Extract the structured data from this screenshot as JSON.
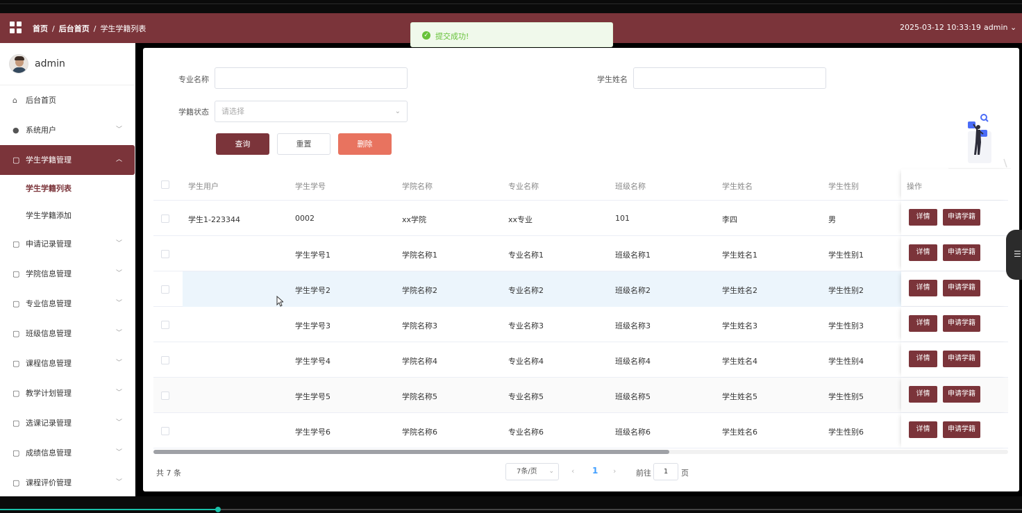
{
  "header": {
    "breadcrumbs": [
      "首页",
      "后台首页",
      "学生学籍列表"
    ],
    "datetime": "2025-03-12 10:33:19",
    "user": "admin",
    "bg_color": "#7b343a"
  },
  "toast": {
    "message": "提交成功!",
    "type": "success"
  },
  "sidebar": {
    "username": "admin",
    "items": [
      {
        "label": "后台首页",
        "icon": "home-icon",
        "expandable": false
      },
      {
        "label": "系统用户",
        "icon": "user-icon",
        "expandable": true
      },
      {
        "label": "学生学籍管理",
        "icon": "folder-icon",
        "expandable": true,
        "active": true
      },
      {
        "label": "申请记录管理",
        "icon": "folder-icon",
        "expandable": true
      },
      {
        "label": "学院信息管理",
        "icon": "folder-icon",
        "expandable": true
      },
      {
        "label": "专业信息管理",
        "icon": "folder-icon",
        "expandable": true
      },
      {
        "label": "班级信息管理",
        "icon": "folder-icon",
        "expandable": true
      },
      {
        "label": "课程信息管理",
        "icon": "folder-icon",
        "expandable": true
      },
      {
        "label": "教学计划管理",
        "icon": "folder-icon",
        "expandable": true
      },
      {
        "label": "选课记录管理",
        "icon": "folder-icon",
        "expandable": true
      },
      {
        "label": "成绩信息管理",
        "icon": "folder-icon",
        "expandable": true
      },
      {
        "label": "课程评价管理",
        "icon": "folder-icon",
        "expandable": true
      }
    ],
    "subitems": [
      "学生学籍列表",
      "学生学籍添加"
    ]
  },
  "search": {
    "major_label": "专业名称",
    "major_value": "",
    "name_label": "学生姓名",
    "name_value": "",
    "status_label": "学籍状态",
    "status_placeholder": "请选择",
    "query_button": "查询",
    "reset_button": "重置",
    "delete_button": "删除"
  },
  "table": {
    "columns": [
      "学生用户",
      "学生学号",
      "学院名称",
      "专业名称",
      "班级名称",
      "学生姓名",
      "学生性别",
      "操作"
    ],
    "rows": [
      [
        "学生1-223344",
        "0002",
        "xx学院",
        "xx专业",
        "101",
        "李四",
        "男"
      ],
      [
        "",
        "学生学号1",
        "学院名称1",
        "专业名称1",
        "班级名称1",
        "学生姓名1",
        "学生性别1"
      ],
      [
        "",
        "学生学号2",
        "学院名称2",
        "专业名称2",
        "班级名称2",
        "学生姓名2",
        "学生性别2"
      ],
      [
        "",
        "学生学号3",
        "学院名称3",
        "专业名称3",
        "班级名称3",
        "学生姓名3",
        "学生性别3"
      ],
      [
        "",
        "学生学号4",
        "学院名称4",
        "专业名称4",
        "班级名称4",
        "学生姓名4",
        "学生性别4"
      ],
      [
        "",
        "学生学号5",
        "学院名称5",
        "专业名称5",
        "班级名称5",
        "学生姓名5",
        "学生性别5"
      ],
      [
        "",
        "学生学号6",
        "学院名称6",
        "专业名称6",
        "班级名称6",
        "学生姓名6",
        "学生性别6"
      ]
    ],
    "detail_button": "详情",
    "apply_button": "申请学籍"
  },
  "pagination": {
    "total_text": "共 7 条",
    "page_size": "7条/页",
    "current_page": "1",
    "goto_label": "前往",
    "goto_value": "1",
    "goto_unit": "页"
  },
  "video": {
    "progress": 0.213
  }
}
